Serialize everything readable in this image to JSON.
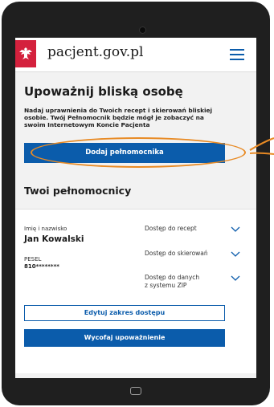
{
  "header": {
    "site_title": "pacjent.gov.pl",
    "logo_icon": "polish-eagle-emblem",
    "menu_icon": "hamburger-icon"
  },
  "main": {
    "heading": "Upoważnij bliską osobę",
    "description": "Nadaj uprawnienia do Twoich recept i skierowań bliskiej osobie. Twój Pełnomocnik będzie mógł je zobaczyć na swoim Internetowym Koncie Pacjenta",
    "add_button_label": "Dodaj pełnomocnika"
  },
  "proxies": {
    "heading": "Twoi pełnomocnicy",
    "name_label": "Imię i nazwisko",
    "name_value": "Jan Kowalski",
    "pesel_label": "PESEL",
    "pesel_value": "810********",
    "access_items": [
      {
        "label": "Dostęp do recept"
      },
      {
        "label": "Dostęp do skierowań"
      },
      {
        "label": "Dostęp do danych\nz systemu ZIP"
      }
    ],
    "edit_button_label": "Edytuj zakres dostępu",
    "revoke_button_label": "Wycofaj upoważnienie"
  },
  "colors": {
    "accent": "#0b5cab",
    "flag_red": "#d4213d",
    "highlight": "#e88a24"
  }
}
